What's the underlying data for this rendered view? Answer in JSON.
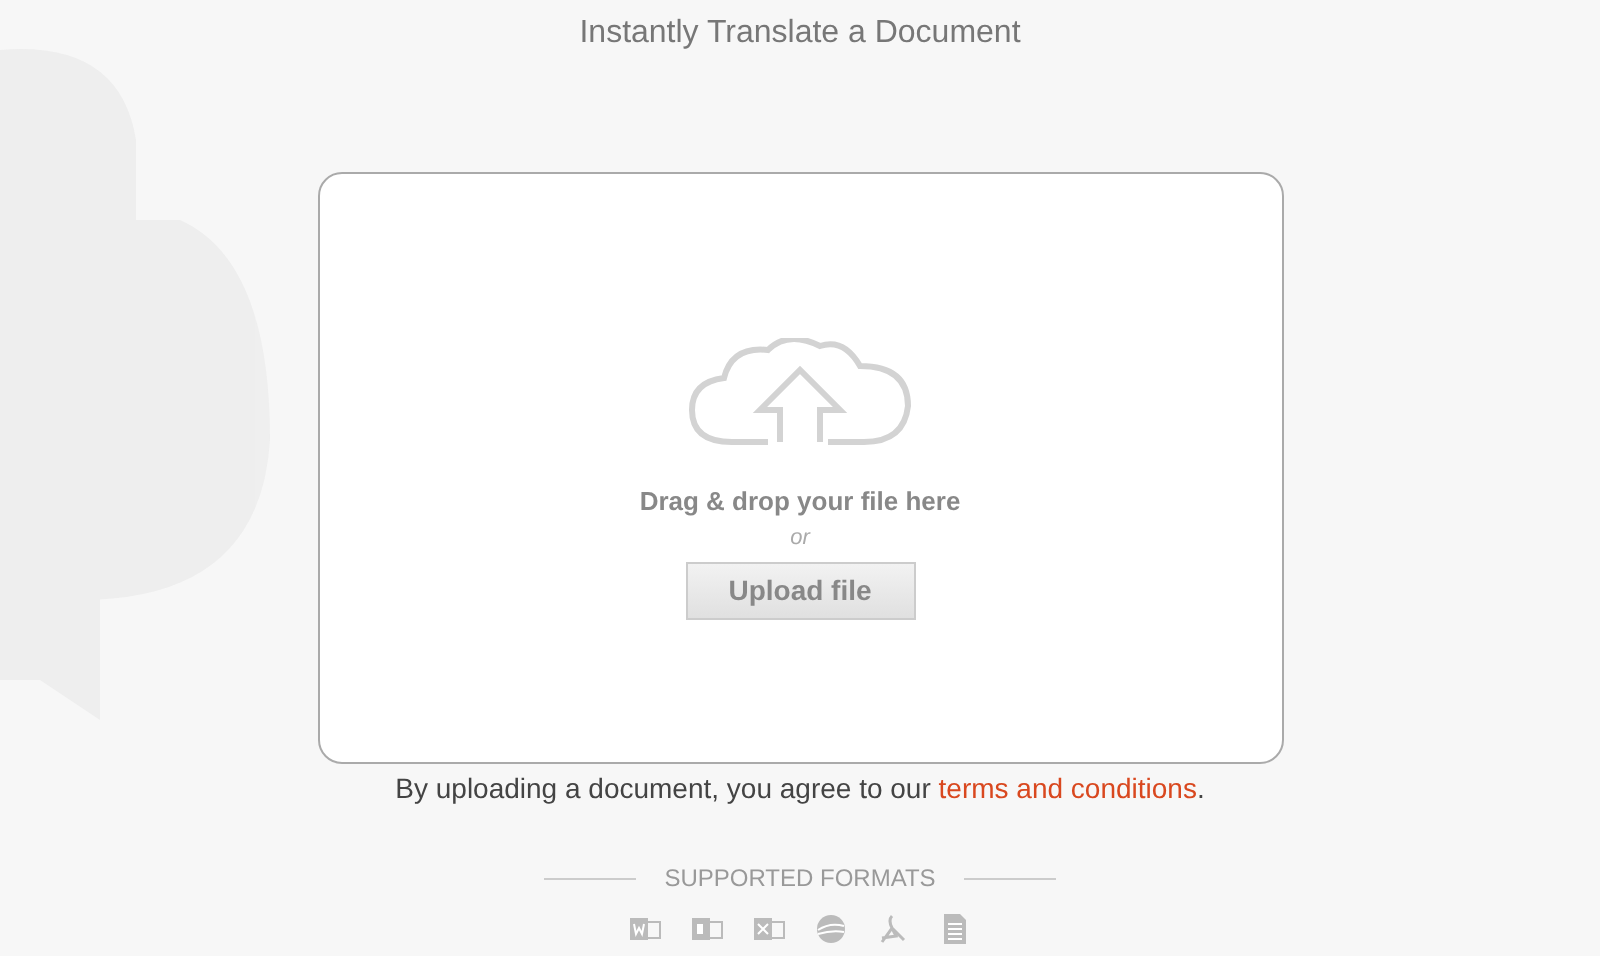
{
  "title": "Instantly Translate a Document",
  "upload": {
    "prompt": "Drag & drop your file here",
    "or": "or",
    "button": "Upload file"
  },
  "agreement": {
    "text": "By uploading a document, you agree to our ",
    "link": "terms and conditions",
    "end": "."
  },
  "formats": {
    "heading": "SUPPORTED FORMATS",
    "items": [
      {
        "kind": "word"
      },
      {
        "kind": "powerpoint"
      },
      {
        "kind": "excel"
      },
      {
        "kind": "web"
      },
      {
        "kind": "pdf"
      },
      {
        "kind": "text"
      }
    ]
  }
}
